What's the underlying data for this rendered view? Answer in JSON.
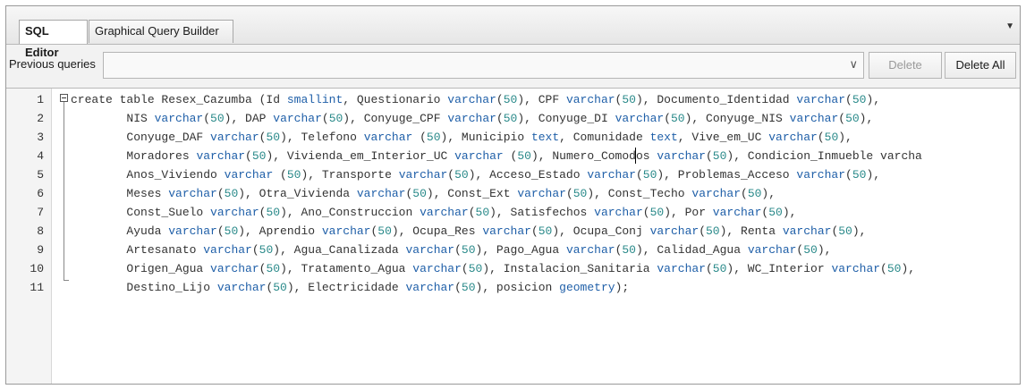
{
  "tabs": [
    {
      "label": "SQL Editor",
      "active": true
    },
    {
      "label": "Graphical Query Builder",
      "active": false
    }
  ],
  "tab_menu_icon": "dropdown-arrow-icon",
  "queries": {
    "label": "Previous queries",
    "selected": "",
    "delete_label": "Delete",
    "delete_all_label": "Delete All"
  },
  "colors": {
    "type_keyword": "#1f5fa8",
    "number": "#2a8a8a",
    "text": "#333333"
  },
  "editor": {
    "lines": [
      {
        "n": "1",
        "text": "create table Resex_Cazumba (Id smallint, Questionario varchar(50), CPF varchar(50), Documento_Identidad varchar(50),"
      },
      {
        "n": "2",
        "text": "        NIS varchar(50), DAP varchar(50), Conyuge_CPF varchar(50), Conyuge_DI varchar(50), Conyuge_NIS varchar(50),"
      },
      {
        "n": "3",
        "text": "        Conyuge_DAF varchar(50), Telefono varchar (50), Municipio text, Comunidade text, Vive_em_UC varchar(50),"
      },
      {
        "n": "4",
        "text": "        Moradores varchar(50), Vivienda_em_Interior_UC varchar (50), Numero_Comodos varchar(50), Condicion_Inmueble varcha"
      },
      {
        "n": "5",
        "text": "        Anos_Viviendo varchar (50), Transporte varchar(50), Acceso_Estado varchar(50), Problemas_Acceso varchar(50),"
      },
      {
        "n": "6",
        "text": "        Meses varchar(50), Otra_Vivienda varchar(50), Const_Ext varchar(50), Const_Techo varchar(50),"
      },
      {
        "n": "7",
        "text": "        Const_Suelo varchar(50), Ano_Construccion varchar(50), Satisfechos varchar(50), Por varchar(50),"
      },
      {
        "n": "8",
        "text": "        Ayuda varchar(50), Aprendio varchar(50), Ocupa_Res varchar(50), Ocupa_Conj varchar(50), Renta varchar(50),"
      },
      {
        "n": "9",
        "text": "        Artesanato varchar(50), Agua_Canalizada varchar(50), Pago_Agua varchar(50), Calidad_Agua varchar(50),"
      },
      {
        "n": "10",
        "text": "        Origen_Agua varchar(50), Tratamento_Agua varchar(50), Instalacion_Sanitaria varchar(50), WC_Interior varchar(50),"
      },
      {
        "n": "11",
        "text": "        Destino_Lijo varchar(50), Electricidade varchar(50), posicion geometry);"
      }
    ]
  }
}
